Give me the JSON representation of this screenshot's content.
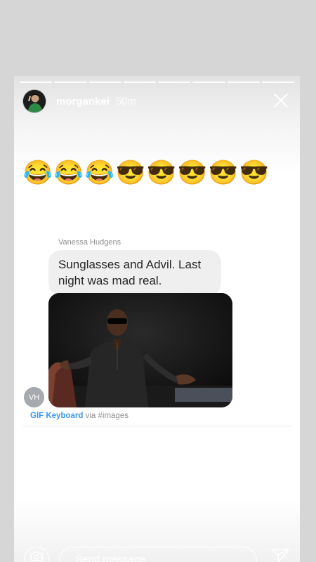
{
  "story": {
    "progress_segments": 8,
    "username": "morgankei",
    "time": "50m"
  },
  "emojis": [
    "😂",
    "😂",
    "😂",
    "😎",
    "😎",
    "😎",
    "😎",
    "😎"
  ],
  "message": {
    "sender": "Vanessa Hudgens",
    "text": "Sunglasses and Advil. Last night was mad real.",
    "avatar_initials": "VH",
    "gif_brand": "GIF Keyboard",
    "gif_via": " via #images"
  },
  "footer": {
    "placeholder": "Send message"
  },
  "colors": {
    "link_blue": "#3897f0",
    "bubble_gray": "#efefef",
    "avatar_gray": "#a6a9ad"
  }
}
